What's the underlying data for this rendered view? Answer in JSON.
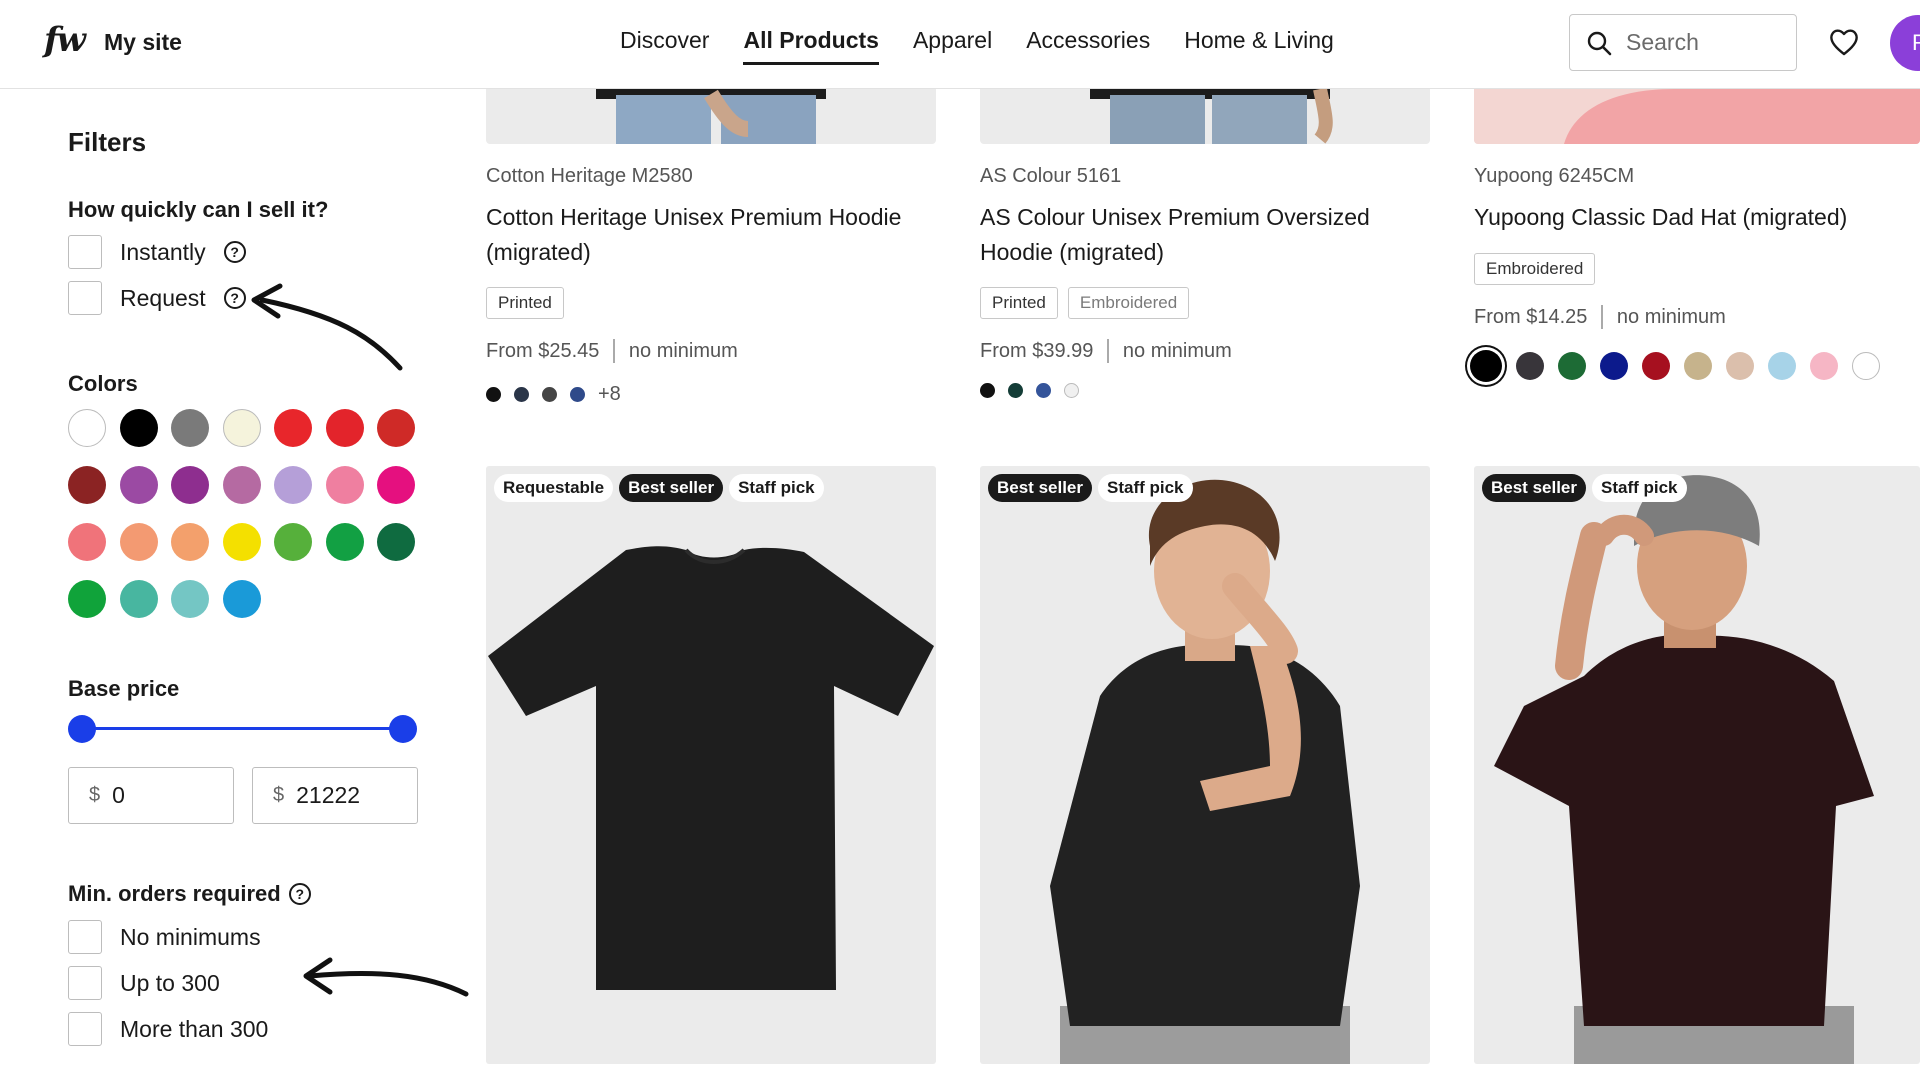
{
  "header": {
    "logo": "fw",
    "site_name": "My site",
    "nav": [
      "Discover",
      "All Products",
      "Apparel",
      "Accessories",
      "Home & Living"
    ],
    "active_nav": "All Products",
    "search_placeholder": "Search",
    "avatar_initial": "R"
  },
  "filters": {
    "title": "Filters",
    "sell_speed": {
      "title": "How quickly can I sell it?",
      "options": [
        "Instantly",
        "Request"
      ]
    },
    "colors": {
      "title": "Colors",
      "swatches": [
        "#ffffff",
        "#000000",
        "#7a7a7a",
        "#f5f3dc",
        "#e8262b",
        "#e3242b",
        "#cf2a27",
        "#8b2323",
        "#9b4aa3",
        "#8e2e8f",
        "#b56aa2",
        "#b59fd8",
        "#ef7fa0",
        "#e5107f",
        "#f0737a",
        "#f39a72",
        "#f3a06c",
        "#f4e000",
        "#56b03b",
        "#12a043",
        "#0f6b40",
        "#10a33a",
        "#48b6a0",
        "#74c6c4",
        "#1a9ad8"
      ]
    },
    "base_price": {
      "title": "Base price",
      "currency": "$",
      "min": "0",
      "max": "21222"
    },
    "min_orders": {
      "title": "Min. orders required",
      "options": [
        "No minimums",
        "Up to 300",
        "More than 300"
      ]
    },
    "help_glyph": "?"
  },
  "products_top": [
    {
      "brand": "Cotton Heritage M2580",
      "name": "Cotton Heritage Unisex Premium Hoodie (migrated)",
      "tags": [
        "Printed"
      ],
      "price": "From $25.45",
      "minimum": "no minimum",
      "dots": [
        "#111111",
        "#2a3548",
        "#454545",
        "#2f4a8a"
      ],
      "more": "+8"
    },
    {
      "brand": "AS Colour 5161",
      "name": "AS Colour Unisex Premium Oversized Hoodie (migrated)",
      "tags": [
        "Printed",
        "Embroidered"
      ],
      "price": "From $39.99",
      "minimum": "no minimum",
      "dots": [
        "#111111",
        "#143d37",
        "#34549a",
        "#f0f0f0"
      ]
    },
    {
      "brand": "Yupoong 6245CM",
      "name": "Yupoong Classic Dad Hat (migrated)",
      "tags": [
        "Embroidered"
      ],
      "price": "From $14.25",
      "minimum": "no minimum",
      "dots": [
        "#000000",
        "#38353a",
        "#1d6b35",
        "#0c1a8c",
        "#a6101f",
        "#c6b38c",
        "#dbbfac",
        "#a7d3e8",
        "#f6b6c5",
        "#ffffff"
      ]
    }
  ],
  "products_bottom": [
    {
      "badges": [
        "Requestable",
        "Best seller",
        "Staff pick"
      ],
      "badge_styles": [
        "light",
        "dark",
        "light"
      ]
    },
    {
      "badges": [
        "Best seller",
        "Staff pick"
      ],
      "badge_styles": [
        "dark",
        "light"
      ]
    },
    {
      "badges": [
        "Best seller",
        "Staff pick"
      ],
      "badge_styles": [
        "dark",
        "light"
      ]
    }
  ]
}
